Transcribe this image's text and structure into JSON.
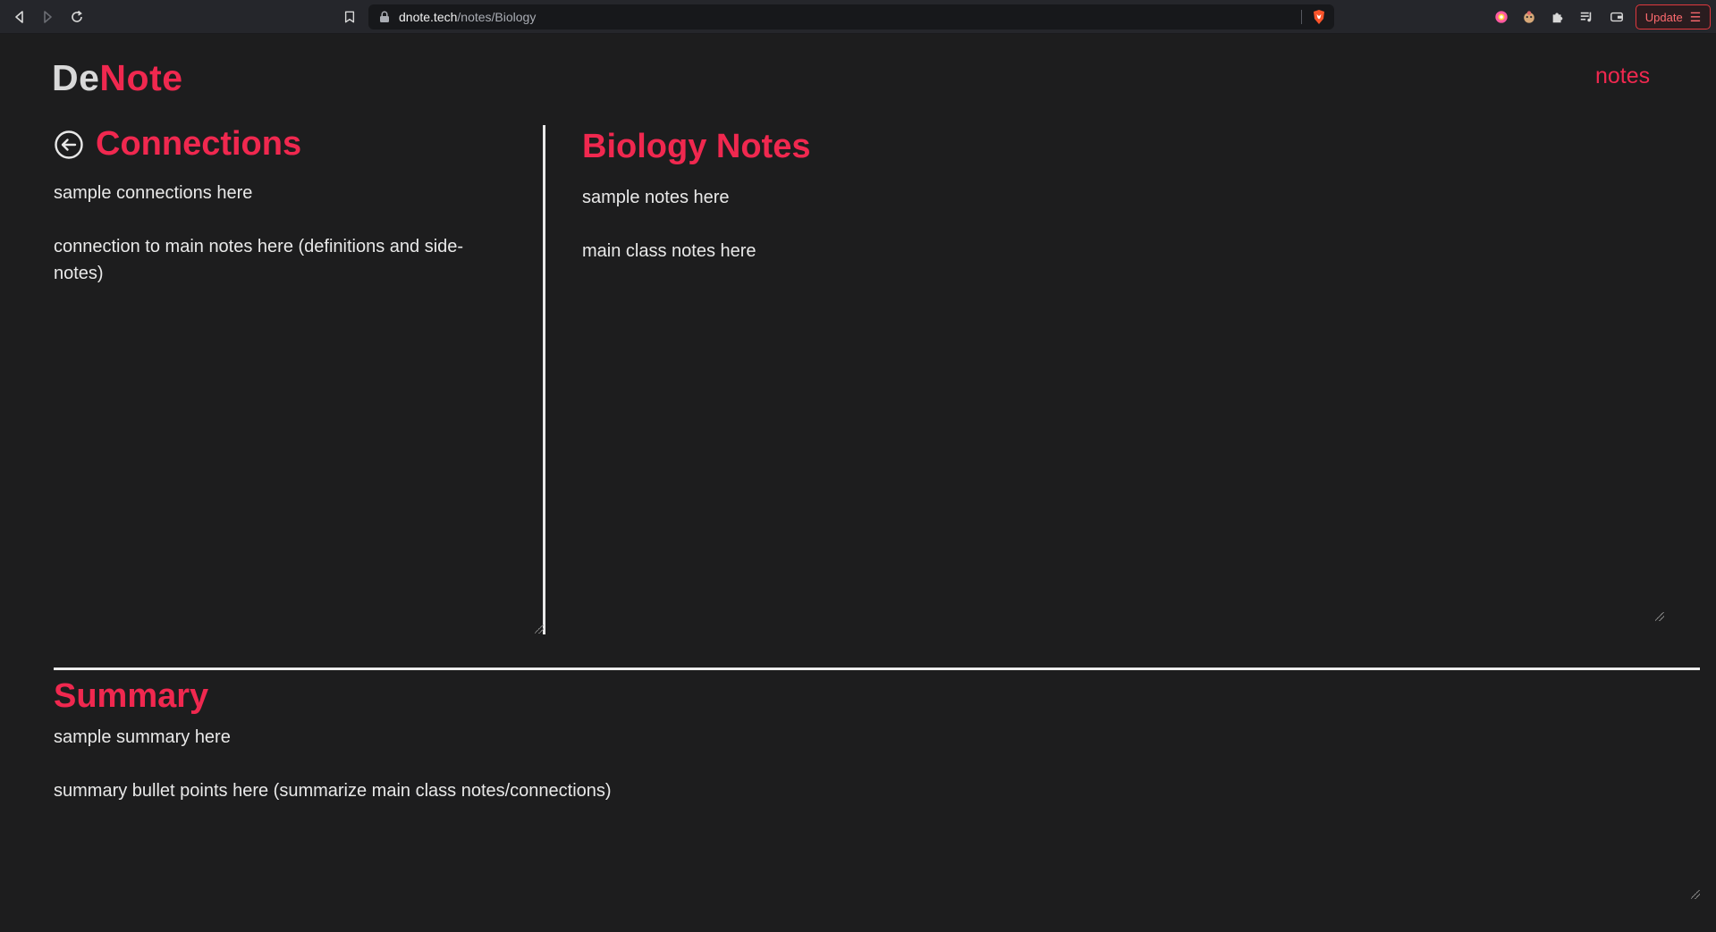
{
  "browser": {
    "url_host": "dnote.tech",
    "url_path": "/notes/Biology",
    "update_label": "Update",
    "accent": "#e0383e"
  },
  "header": {
    "logo_de": "De",
    "logo_note": "Note",
    "nav_link": "notes"
  },
  "connections": {
    "title": "Connections",
    "paragraphs": [
      "sample connections here",
      "connection to main notes here  (definitions and side-notes)"
    ]
  },
  "notes": {
    "title": "Biology Notes",
    "paragraphs": [
      "sample notes here",
      "main class notes here"
    ]
  },
  "summary": {
    "title": "Summary",
    "paragraphs": [
      "sample summary here",
      "summary bullet points here (summarize main class notes/connections)"
    ]
  },
  "colors": {
    "background": "#1d1d1e",
    "accent": "#f0284f",
    "text": "#e9e9e9"
  }
}
